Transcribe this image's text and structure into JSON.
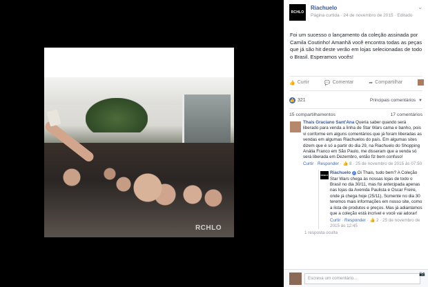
{
  "photo": {
    "watermark": "RCHLO"
  },
  "post": {
    "logo_text": "RCHLO",
    "page_name": "Riachuelo",
    "meta": "Página curtida · 24 de novembro de 2015 · Editado",
    "text": "Foi um sucesso o lançamento da coleção assinada por Camila Coutinho! Amanhã você encontra todas as peças que já são hit deste verão em lojas selecionadas de todo o Brasil. Esperamos vocês!"
  },
  "actions": {
    "like": "Curtir",
    "comment": "Comentar",
    "share": "Compartilhar"
  },
  "stats": {
    "likes_count": "321",
    "top_comments": "Principais comentários",
    "shares": "15 compartilhamentos",
    "comments": "17 comentários"
  },
  "comments": [
    {
      "author": "Thais Graciano Sant'Ana",
      "text": "Queria saber quando será liberado para venda a linha de Star Wars cama e banho, pois vi conforme em alguns comentários que já foram liberadas as vendas em algumas Riachuelos do país. Em algumas sites dizem que é só a partir do dia 29, na Riachuelo do Shopping Anália Franco em São Paulo, me disseram que a venda só será liberada em Dezembro, então fiz bem confuso!",
      "like_link": "Curtir",
      "reply_link": "Responder",
      "reactions": "8",
      "date": "25 de novembro de 2015 às 07:50",
      "reply": {
        "logo_text": "RCHLO",
        "author": "Riachuelo",
        "text": "Oi Thais, tudo bem? A Coleção Star Wars chega às nossas lojas de todo o Brasil no dia 30/11, mas foi antecipada apenas nas lojas da Avenida Paulista e Oscar Freire, onde já chega hoje (25/11). Somente no dia 30 teremos mais informações em nosso site, como a lista de produtos e preços. Mas já adiantamos que a coleção está incrível e você vai adorar!",
        "like_link": "Curtir",
        "reply_link": "Responder",
        "reactions": "2",
        "date": "25 de novembro de 2015 às 12:45"
      }
    }
  ],
  "hidden_replies": "1 resposta oculta",
  "composer": {
    "placeholder": "Escreva um comentário..."
  }
}
